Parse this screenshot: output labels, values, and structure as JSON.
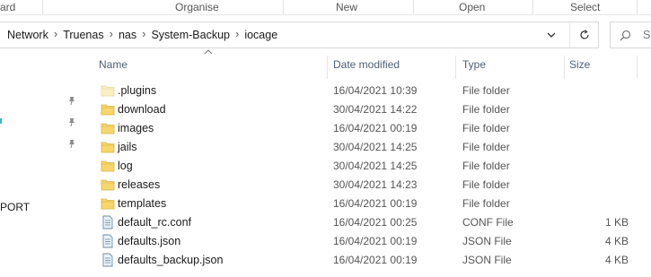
{
  "ribbon": {
    "groups": [
      "ard",
      "Organise",
      "New",
      "Open",
      "Select"
    ]
  },
  "address": {
    "crumbs": [
      "Network",
      "Truenas",
      "nas",
      "System-Backup",
      "iocage"
    ],
    "search_placeholder": "S"
  },
  "nav": {
    "partial_item": "PORT"
  },
  "columns": {
    "name": "Name",
    "date": "Date modified",
    "type": "Type",
    "size": "Size"
  },
  "files": [
    {
      "name": ".plugins",
      "date": "16/04/2021 10:39",
      "type": "File folder",
      "size": "",
      "icon": "folder-icon",
      "faded": true
    },
    {
      "name": "download",
      "date": "30/04/2021 14:22",
      "type": "File folder",
      "size": "",
      "icon": "folder-icon"
    },
    {
      "name": "images",
      "date": "16/04/2021 00:19",
      "type": "File folder",
      "size": "",
      "icon": "folder-icon"
    },
    {
      "name": "jails",
      "date": "30/04/2021 14:25",
      "type": "File folder",
      "size": "",
      "icon": "folder-icon"
    },
    {
      "name": "log",
      "date": "30/04/2021 14:25",
      "type": "File folder",
      "size": "",
      "icon": "folder-icon"
    },
    {
      "name": "releases",
      "date": "30/04/2021 14:23",
      "type": "File folder",
      "size": "",
      "icon": "folder-icon"
    },
    {
      "name": "templates",
      "date": "16/04/2021 00:19",
      "type": "File folder",
      "size": "",
      "icon": "folder-icon"
    },
    {
      "name": "default_rc.conf",
      "date": "16/04/2021 00:25",
      "type": "CONF File",
      "size": "1 KB",
      "icon": "text-file-icon"
    },
    {
      "name": "defaults.json",
      "date": "16/04/2021 00:19",
      "type": "JSON File",
      "size": "4 KB",
      "icon": "text-file-icon"
    },
    {
      "name": "defaults_backup.json",
      "date": "16/04/2021 00:19",
      "type": "JSON File",
      "size": "4 KB",
      "icon": "text-file-icon"
    }
  ],
  "colors": {
    "folder": "#f7d66b",
    "folder_faded": "#fbefc2",
    "header_text": "#4c607a"
  }
}
